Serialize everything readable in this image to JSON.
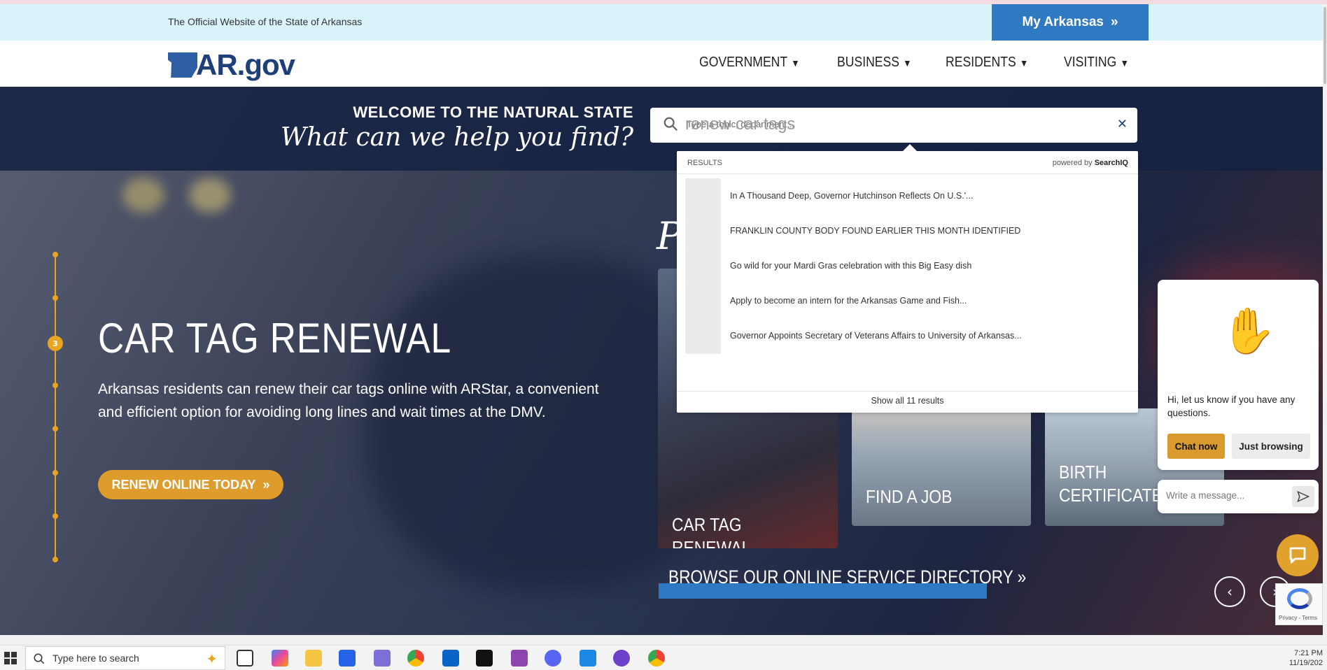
{
  "header": {
    "official_text": "The Official Website of the State of Arkansas",
    "my_arkansas_label": "My Arkansas",
    "logo_text": "AR.gov"
  },
  "nav": {
    "items": [
      {
        "label": "GOVERNMENT"
      },
      {
        "label": "BUSINESS"
      },
      {
        "label": "RESIDENTS"
      },
      {
        "label": "VISITING"
      }
    ]
  },
  "search": {
    "welcome_top": "WELCOME TO THE NATURAL STATE",
    "welcome_script": "What can we help you find?",
    "value": "renew car tags",
    "placeholder": "Type a topic, department...",
    "results_label": "RESULTS",
    "powered_by_prefix": "powered by ",
    "powered_by_brand": "SearchIQ",
    "results": [
      {
        "title": "In A Thousand Deep, Governor Hutchinson Reflects On U.S.'..."
      },
      {
        "title": "FRANKLIN COUNTY BODY FOUND EARLIER THIS MONTH IDENTIFIED"
      },
      {
        "title": "Go wild for your Mardi Gras celebration with this Big Easy dish"
      },
      {
        "title": "Apply to become an intern for the Arkansas Game and Fish..."
      },
      {
        "title": "Governor Appoints Secretary of Veterans Affairs to University of Arkansas..."
      }
    ],
    "show_all": "Show all 11 results"
  },
  "slide": {
    "index": "3",
    "title": "CAR TAG RENEWAL",
    "description": "Arkansas residents can renew their car tags online with ARStar, a convenient and efficient option for avoiding long lines and wait times at the DMV.",
    "cta": "RENEW ONLINE TODAY"
  },
  "popular": {
    "heading_fragment": "P",
    "cards": [
      {
        "label": "CAR TAG RENEWAL"
      },
      {
        "label": "FIND A JOB"
      },
      {
        "label": "BIRTH CERTIFICATES"
      }
    ],
    "browse_label": "BROWSE OUR ONLINE SERVICE DIRECTORY"
  },
  "chat": {
    "message": "Hi, let us know if you have any questions.",
    "chat_now": "Chat now",
    "just_browsing": "Just browsing",
    "input_placeholder": "Write a message..."
  },
  "recaptcha": {
    "links": "Privacy - Terms"
  },
  "taskbar": {
    "search_placeholder": "Type here to search",
    "time": "7:21 PM",
    "date": "11/19/202"
  },
  "colors": {
    "brand_blue": "#2e79c1",
    "accent_gold": "#dd9c2c",
    "navy": "#1f3f78"
  }
}
